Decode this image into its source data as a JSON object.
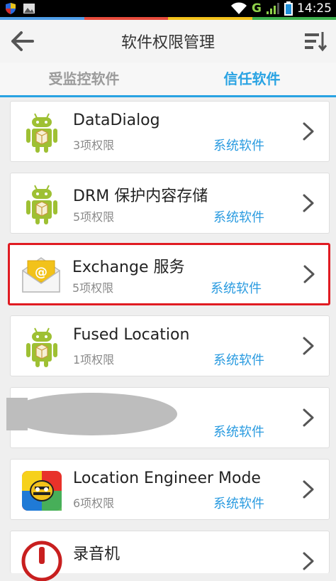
{
  "status_bar": {
    "network": "G",
    "time": "14:25"
  },
  "header": {
    "title": "软件权限管理"
  },
  "tabs": [
    {
      "label": "受监控软件",
      "active": false
    },
    {
      "label": "信任软件",
      "active": true
    }
  ],
  "apps": [
    {
      "name": "DataDialog",
      "permissions": "3项权限",
      "tag": "系统软件",
      "icon": "android-icon"
    },
    {
      "name": "DRM 保护内容存储",
      "permissions": "5项权限",
      "tag": "系统软件",
      "icon": "android-icon"
    },
    {
      "name": "Exchange 服务",
      "permissions": "5项权限",
      "tag": "系统软件",
      "icon": "email-icon",
      "highlighted": true
    },
    {
      "name": "Fused Location",
      "permissions": "1项权限",
      "tag": "系统软件",
      "icon": "android-icon"
    },
    {
      "name": "",
      "permissions": "",
      "tag": "系统软件",
      "icon": "redacted"
    },
    {
      "name": "Location Engineer Mode",
      "permissions": "6项权限",
      "tag": "系统软件",
      "icon": "bee-icon"
    },
    {
      "name": "录音机",
      "permissions": "",
      "tag": "",
      "icon": "recorder-icon"
    }
  ],
  "colors": {
    "accent": "#29a3e3",
    "highlight": "#e01b22"
  }
}
